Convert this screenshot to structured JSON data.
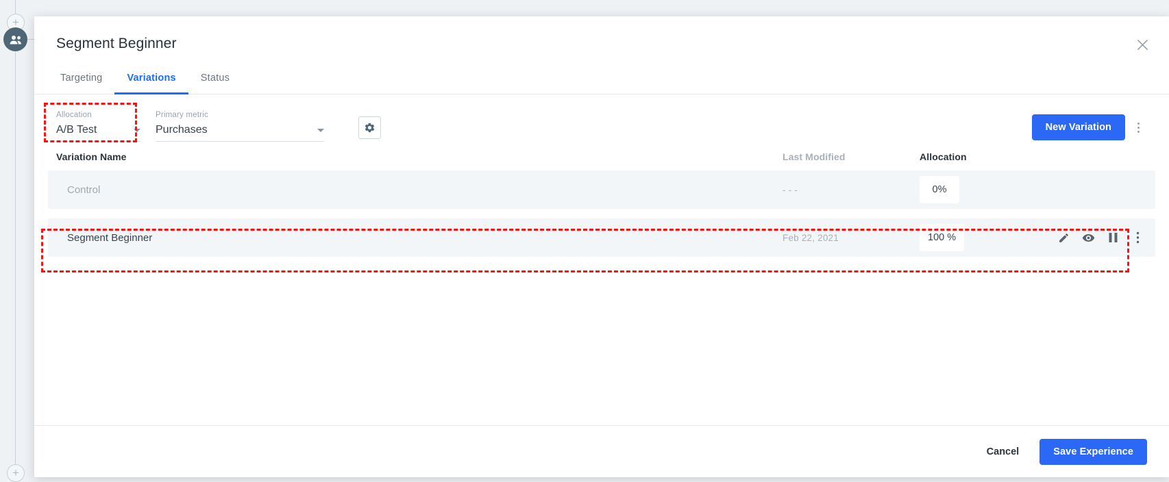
{
  "background": {
    "audience_node_icon": "people-icon",
    "add_node_icon": "plus-icon",
    "node_color": "#4e6675"
  },
  "modal": {
    "title": "Segment Beginner",
    "close_icon": "close-icon",
    "tabs": [
      {
        "label": "Targeting",
        "active": false
      },
      {
        "label": "Variations",
        "active": true
      },
      {
        "label": "Status",
        "active": false
      }
    ],
    "controls": {
      "allocation": {
        "label": "Allocation",
        "value": "A/B Test",
        "caret_icon": "chevron-down-icon"
      },
      "primary_metric": {
        "label": "Primary metric",
        "value": "Purchases",
        "caret_icon": "chevron-down-icon"
      },
      "settings_icon": "gear-icon",
      "new_variation_label": "New Variation",
      "overflow_icon": "more-vertical-icon"
    },
    "table": {
      "columns": [
        {
          "label": "Variation Name",
          "muted": false
        },
        {
          "label": "Last Modified",
          "muted": true
        },
        {
          "label": "Allocation",
          "muted": false
        }
      ],
      "rows": [
        {
          "name": "Control",
          "last_modified": "- - -",
          "allocation": "0%",
          "disabled": true,
          "actions": []
        },
        {
          "name": "Segment Beginner",
          "last_modified": "Feb 22, 2021",
          "allocation": "100 %",
          "disabled": false,
          "actions": [
            "edit-icon",
            "preview-eye-icon",
            "pause-icon",
            "more-vertical-icon"
          ]
        }
      ]
    },
    "footer": {
      "cancel_label": "Cancel",
      "save_label": "Save Experience"
    }
  },
  "colors": {
    "accent": "#2b68f6",
    "tab_active": "#1a6dff",
    "annotation": "#f51414",
    "row_bg": "#f3f6f9"
  }
}
